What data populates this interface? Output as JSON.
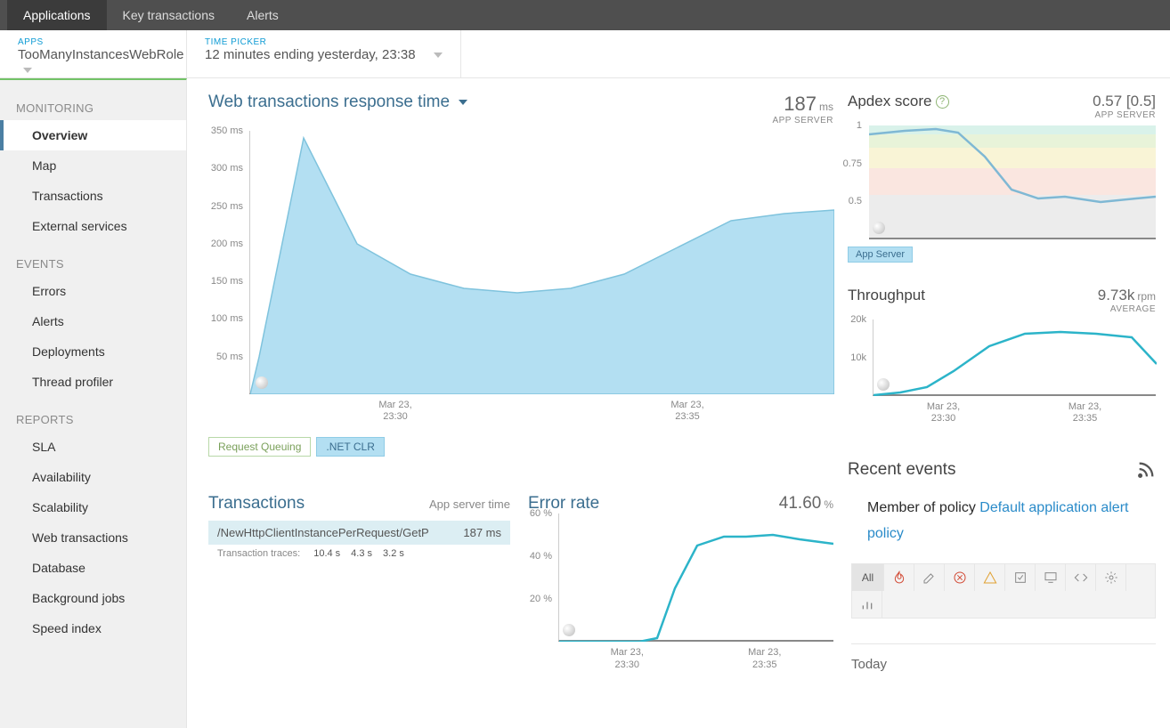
{
  "topnav": {
    "items": [
      "Applications",
      "Key transactions",
      "Alerts"
    ],
    "active": 0
  },
  "pickers": {
    "apps": {
      "label": "APPS",
      "value": "TooManyInstancesWebRole"
    },
    "time": {
      "label": "TIME PICKER",
      "value": "12 minutes ending yesterday, 23:38"
    }
  },
  "sidebar": {
    "sections": [
      {
        "label": "MONITORING",
        "items": [
          "Overview",
          "Map",
          "Transactions",
          "External services"
        ],
        "activeIndex": 0
      },
      {
        "label": "EVENTS",
        "items": [
          "Errors",
          "Alerts",
          "Deployments",
          "Thread profiler"
        ]
      },
      {
        "label": "REPORTS",
        "items": [
          "SLA",
          "Availability",
          "Scalability",
          "Web transactions",
          "Database",
          "Background jobs",
          "Speed index"
        ]
      }
    ]
  },
  "response": {
    "title": "Web transactions response time",
    "value": "187",
    "unit": "ms",
    "sub": "APP SERVER",
    "chips": [
      "Request Queuing",
      ".NET CLR"
    ]
  },
  "apdex": {
    "title": "Apdex score",
    "value": "0.57 [0.5]",
    "sub": "APP SERVER"
  },
  "throughput": {
    "title": "Throughput",
    "value": "9.73k",
    "unit": "rpm",
    "sub": "AVERAGE"
  },
  "transactions": {
    "title": "Transactions",
    "meta": "App server time",
    "row": {
      "name": "/NewHttpClientInstancePerRequest/GetP",
      "time": "187 ms"
    },
    "traces": {
      "label": "Transaction traces:",
      "vals": [
        "10.4 s",
        "4.3 s",
        "3.2 s"
      ]
    }
  },
  "error": {
    "title": "Error rate",
    "value": "41.60",
    "unit": "%"
  },
  "recent": {
    "title": "Recent events",
    "policy_prefix": "Member of policy ",
    "policy_link": "Default application alert policy",
    "filters": [
      "All",
      "flame",
      "pencil",
      "x-circle",
      "warn-triangle",
      "edit-square",
      "monitor",
      "code",
      "gear",
      "bars"
    ],
    "today": "Today"
  },
  "xticks": [
    "Mar 23,\n23:30",
    "Mar 23,\n23:35"
  ],
  "chart_data": [
    {
      "type": "area",
      "title": "Web transactions response time",
      "ylabel": "ms",
      "ylim": [
        0,
        350
      ],
      "x": [
        "23:27",
        "23:28",
        "23:29",
        "23:30",
        "23:31",
        "23:32",
        "23:33",
        "23:34",
        "23:35",
        "23:36",
        "23:37",
        "23:38"
      ],
      "series": [
        {
          "name": ".NET CLR",
          "values": [
            50,
            340,
            200,
            160,
            140,
            135,
            140,
            160,
            195,
            230,
            240,
            245
          ]
        }
      ]
    },
    {
      "type": "line",
      "title": "Apdex score",
      "ylim": [
        0,
        1
      ],
      "x": [
        "23:27",
        "23:28",
        "23:29",
        "23:30",
        "23:31",
        "23:32",
        "23:33",
        "23:34",
        "23:35",
        "23:36",
        "23:37",
        "23:38"
      ],
      "series": [
        {
          "name": "App Server",
          "values": [
            0.95,
            0.97,
            0.98,
            0.96,
            0.85,
            0.65,
            0.52,
            0.5,
            0.51,
            0.48,
            0.5,
            0.51
          ]
        }
      ],
      "bands": [
        {
          "from": 0.94,
          "to": 1,
          "color": "#d9f2ea"
        },
        {
          "from": 0.85,
          "to": 0.94,
          "color": "#e8f3d9"
        },
        {
          "from": 0.7,
          "to": 0.85,
          "color": "#f9f4d6"
        },
        {
          "from": 0.5,
          "to": 0.7,
          "color": "#fae6e0"
        },
        {
          "from": 0,
          "to": 0.5,
          "color": "#ececec"
        }
      ]
    },
    {
      "type": "line",
      "title": "Throughput",
      "ylabel": "rpm",
      "ylim": [
        0,
        20000
      ],
      "x": [
        "23:27",
        "23:28",
        "23:29",
        "23:30",
        "23:31",
        "23:32",
        "23:33",
        "23:34",
        "23:35",
        "23:36",
        "23:37",
        "23:38"
      ],
      "series": [
        {
          "name": "rpm",
          "values": [
            200,
            500,
            1500,
            4000,
            8000,
            12000,
            15000,
            16000,
            16200,
            16000,
            15500,
            9000
          ]
        }
      ]
    },
    {
      "type": "line",
      "title": "Error rate",
      "ylabel": "%",
      "ylim": [
        0,
        60
      ],
      "x": [
        "23:27",
        "23:28",
        "23:29",
        "23:30",
        "23:31",
        "23:32",
        "23:33",
        "23:34",
        "23:35",
        "23:36",
        "23:37",
        "23:38"
      ],
      "series": [
        {
          "name": "error",
          "values": [
            0,
            0,
            0,
            0,
            2,
            25,
            45,
            49,
            49,
            50,
            48,
            46
          ]
        }
      ]
    }
  ]
}
